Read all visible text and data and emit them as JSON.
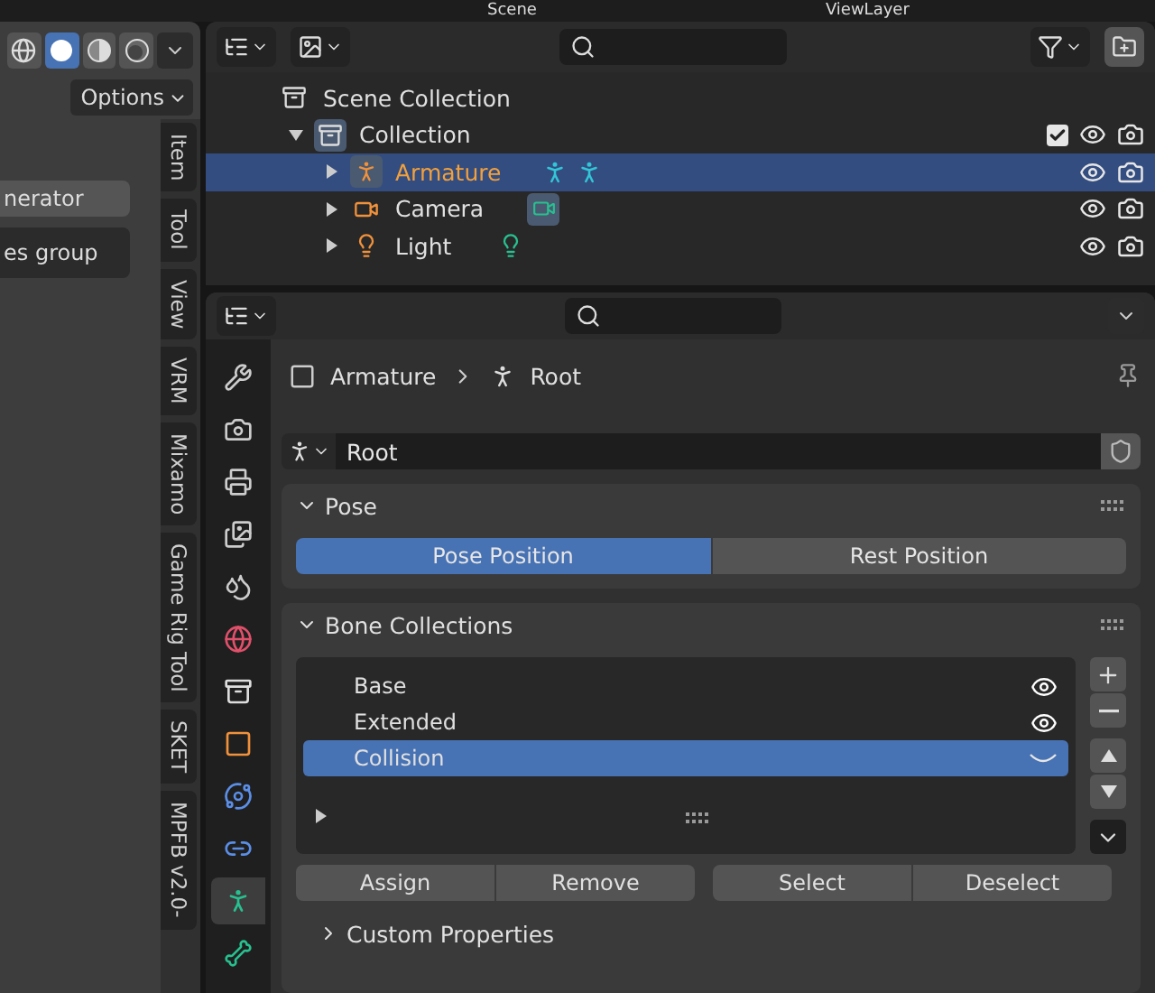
{
  "topbar": {
    "scene": "Scene",
    "view_layer": "ViewLayer"
  },
  "viewport": {
    "shading_modes": [
      {
        "kind": "wireframe",
        "selected": false
      },
      {
        "kind": "solid",
        "selected": true
      },
      {
        "kind": "material",
        "selected": false
      },
      {
        "kind": "rendered",
        "selected": false
      }
    ],
    "options_label": "Options",
    "panel_buttons": [
      {
        "label": "nerator",
        "kind": "light"
      },
      {
        "label": "es group",
        "kind": "dark"
      }
    ],
    "tabs": [
      {
        "label": "Item"
      },
      {
        "label": "Tool"
      },
      {
        "label": "View"
      },
      {
        "label": "VRM"
      },
      {
        "label": "Mixamo"
      },
      {
        "label": "Game Rig Tool"
      },
      {
        "label": "SKET"
      },
      {
        "label": "MPFB v2.0-"
      }
    ]
  },
  "outliner": {
    "rows": [
      {
        "label": "Scene Collection",
        "kind": "scene",
        "selected": false,
        "children": [
          {
            "label": "Collection",
            "kind": "collection",
            "selected": false,
            "expanded": true,
            "checked": true,
            "children": [
              {
                "label": "Armature",
                "kind": "armature",
                "selected": true,
                "expanded": false
              },
              {
                "label": "Camera",
                "kind": "camera",
                "selected": false,
                "expanded": false
              },
              {
                "label": "Light",
                "kind": "light",
                "selected": false,
                "expanded": false
              }
            ]
          }
        ]
      }
    ]
  },
  "properties": {
    "tabs": [
      {
        "kind": "tool",
        "selected": false
      },
      {
        "kind": "render",
        "selected": false
      },
      {
        "kind": "output",
        "selected": false
      },
      {
        "kind": "view_layer",
        "selected": false
      },
      {
        "kind": "scene",
        "selected": false
      },
      {
        "kind": "world",
        "selected": false
      },
      {
        "kind": "collection",
        "selected": false
      },
      {
        "kind": "object",
        "selected": false
      },
      {
        "kind": "physics",
        "selected": false
      },
      {
        "kind": "constraints",
        "selected": false
      },
      {
        "kind": "data",
        "selected": true
      },
      {
        "kind": "bone",
        "selected": false
      }
    ],
    "breadcrumb": [
      "Armature",
      "Root"
    ],
    "datablock": {
      "name": "Root"
    },
    "pose": {
      "title": "Pose",
      "expanded": true,
      "options": [
        {
          "label": "Pose Position",
          "selected": true
        },
        {
          "label": "Rest Position",
          "selected": false
        }
      ]
    },
    "bone_collections": {
      "title": "Bone Collections",
      "expanded": true,
      "items": [
        {
          "label": "Base",
          "selected": false,
          "visible": true
        },
        {
          "label": "Extended",
          "selected": false,
          "visible": true
        },
        {
          "label": "Collision",
          "selected": true,
          "visible": false
        }
      ],
      "buttons": [
        "Assign",
        "Remove",
        "Select",
        "Deselect"
      ],
      "custom_properties": {
        "title": "Custom Properties",
        "expanded": false
      }
    }
  }
}
